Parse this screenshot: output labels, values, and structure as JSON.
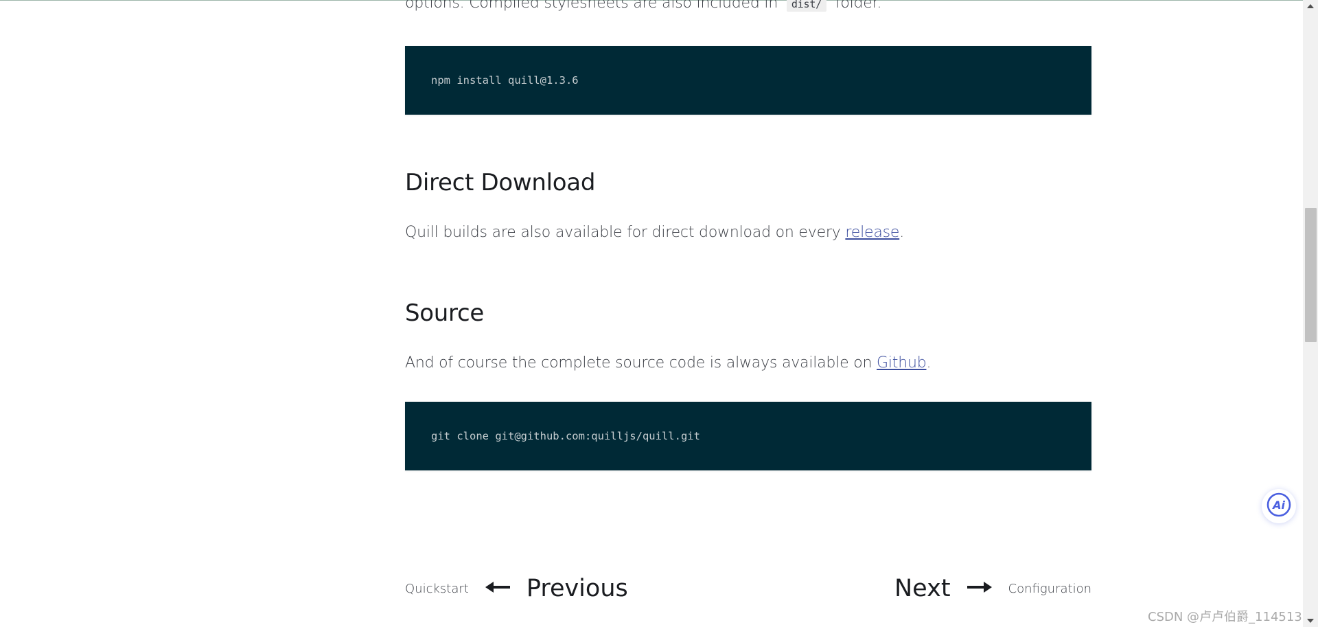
{
  "intro": {
    "text_before": "options. Compiled stylesheets are also included in",
    "inline_code": "dist/",
    "text_after": "folder."
  },
  "npm_block": {
    "code": "npm install quill@1.3.6"
  },
  "direct_download": {
    "heading": "Direct Download",
    "text_before": "Quill builds are also available for direct download on every",
    "link": "release",
    "text_after": "."
  },
  "source": {
    "heading": "Source",
    "text_before": "And of course the complete source code is always available on",
    "link": "Github",
    "text_after": "."
  },
  "git_block": {
    "code": "git clone git@github.com:quilljs/quill.git"
  },
  "pagination": {
    "prev_page": "Quickstart",
    "prev_label": "Previous",
    "next_label": "Next",
    "next_page": "Configuration"
  },
  "ai_button": {
    "label": "Ai"
  },
  "watermark": "CSDN @卢卢伯爵_114513",
  "colors": {
    "code_bg": "#002936",
    "code_text": "#c6cdd0",
    "link": "#3b4d9e",
    "heading": "#1a1c20",
    "body_text": "#3d4047",
    "ai_accent": "#4a5fe0"
  },
  "icons": {
    "prev_arrow": "arrow-left-icon",
    "next_arrow": "arrow-right-icon",
    "scroll_up": "scroll-up-arrow-icon",
    "scroll_down": "scroll-down-arrow-icon",
    "ai": "ai-assistant-icon"
  }
}
